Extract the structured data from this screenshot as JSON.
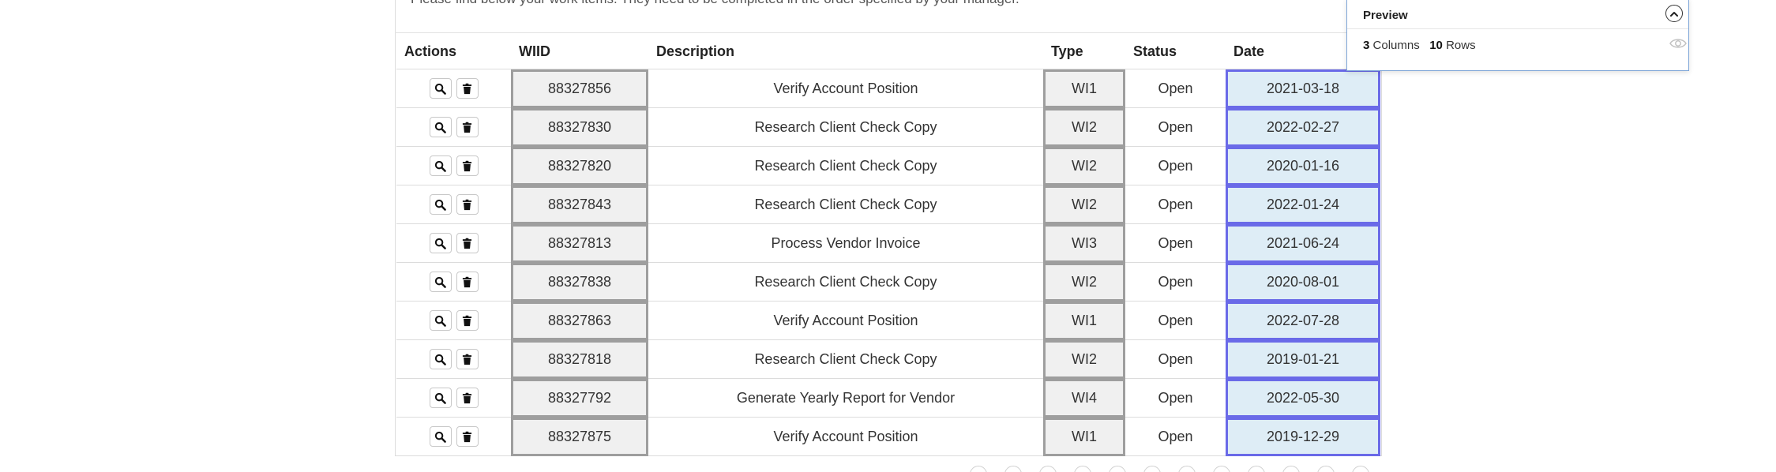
{
  "intro_text": "Please find below your work items. They need to be completed in the order specified by your manager.",
  "table": {
    "headers": {
      "actions": "Actions",
      "wiid": "WIID",
      "description": "Description",
      "type": "Type",
      "status": "Status",
      "date": "Date"
    },
    "rows": [
      {
        "wiid": "88327856",
        "description": "Verify Account Position",
        "type": "WI1",
        "status": "Open",
        "date": "2021-03-18"
      },
      {
        "wiid": "88327830",
        "description": "Research Client Check Copy",
        "type": "WI2",
        "status": "Open",
        "date": "2022-02-27"
      },
      {
        "wiid": "88327820",
        "description": "Research Client Check Copy",
        "type": "WI2",
        "status": "Open",
        "date": "2020-01-16"
      },
      {
        "wiid": "88327843",
        "description": "Research Client Check Copy",
        "type": "WI2",
        "status": "Open",
        "date": "2022-01-24"
      },
      {
        "wiid": "88327813",
        "description": "Process Vendor Invoice",
        "type": "WI3",
        "status": "Open",
        "date": "2021-06-24"
      },
      {
        "wiid": "88327838",
        "description": "Research Client Check Copy",
        "type": "WI2",
        "status": "Open",
        "date": "2020-08-01"
      },
      {
        "wiid": "88327863",
        "description": "Verify Account Position",
        "type": "WI1",
        "status": "Open",
        "date": "2022-07-28"
      },
      {
        "wiid": "88327818",
        "description": "Research Client Check Copy",
        "type": "WI2",
        "status": "Open",
        "date": "2019-01-21"
      },
      {
        "wiid": "88327792",
        "description": "Generate Yearly Report for Vendor",
        "type": "WI4",
        "status": "Open",
        "date": "2022-05-30"
      },
      {
        "wiid": "88327875",
        "description": "Verify Account Position",
        "type": "WI1",
        "status": "Open",
        "date": "2019-12-29"
      }
    ],
    "row_action_icons": [
      "search-icon",
      "trash-icon"
    ]
  },
  "preview": {
    "title": "Preview",
    "columns_count": "3",
    "columns_label": "Columns",
    "rows_count": "10",
    "rows_label": "Rows",
    "icons": [
      "chevron-up-icon",
      "eye-icon"
    ]
  },
  "colors": {
    "date_highlight_border": "#6a6ae8",
    "date_highlight_fill": "#deedf6",
    "selected_column_border": "#9e9e9e",
    "selected_column_fill": "#f0f0f0",
    "preview_border": "#7fa6d8"
  }
}
